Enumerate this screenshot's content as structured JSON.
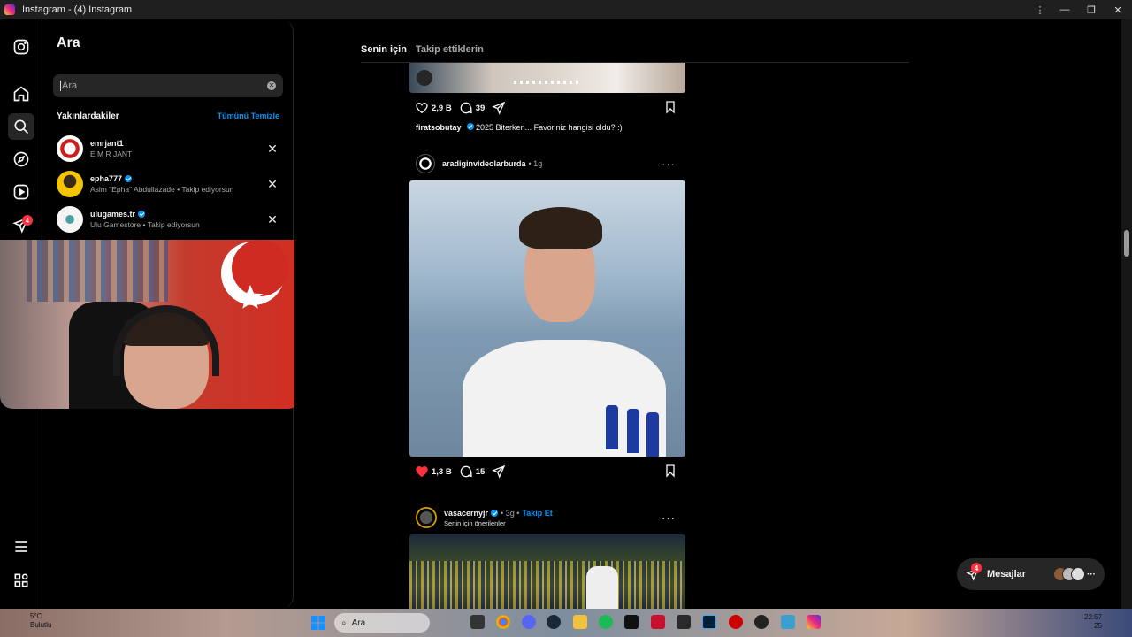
{
  "window": {
    "title": "Instagram - (4) Instagram",
    "controls": [
      "⋮",
      "—",
      "❐",
      "✕"
    ]
  },
  "rail": {
    "notifications_badge": "4"
  },
  "search": {
    "title": "Ara",
    "placeholder": "Ara",
    "recent_label": "Yakınlardakiler",
    "clear_all": "Tümünü Temizle",
    "items": [
      {
        "username": "emrjant1",
        "subtitle": "E M R JANT",
        "verified": false
      },
      {
        "username": "epha777",
        "subtitle": "Asim \"Epha\" Abdullazade • Takip ediyorsun",
        "verified": true
      },
      {
        "username": "ulugames.tr",
        "subtitle": "Ulu Gamestore • Takip ediyorsun",
        "verified": true
      }
    ]
  },
  "feed": {
    "tabs": {
      "for_you": "Senin için",
      "following": "Takip ettiklerin"
    },
    "post1": {
      "likes": "2,9 B",
      "comments": "39",
      "caption_user": "firatsobutay",
      "caption_text": "2025 Biterken... Favoriniz hangisi oldu? :)"
    },
    "post2": {
      "username": "aradiginvideolarburda",
      "time": "• 1g",
      "likes": "1,3 B",
      "comments": "15"
    },
    "post3": {
      "username": "vasacernyjr",
      "time": "• 3g •",
      "follow": "Takip Et",
      "suggested": "Senin için önerilenler"
    },
    "more": "···"
  },
  "messages": {
    "label": "Mesajlar",
    "badge": "4"
  },
  "taskbar": {
    "weather_temp": "5°C",
    "weather_desc": "Bulutlu",
    "search_label": "Ara",
    "time": "22:57",
    "date": "25"
  },
  "colors": {
    "accent": "#0095f6",
    "like": "#ff3040",
    "background": "#000000",
    "panel": "#262626"
  }
}
